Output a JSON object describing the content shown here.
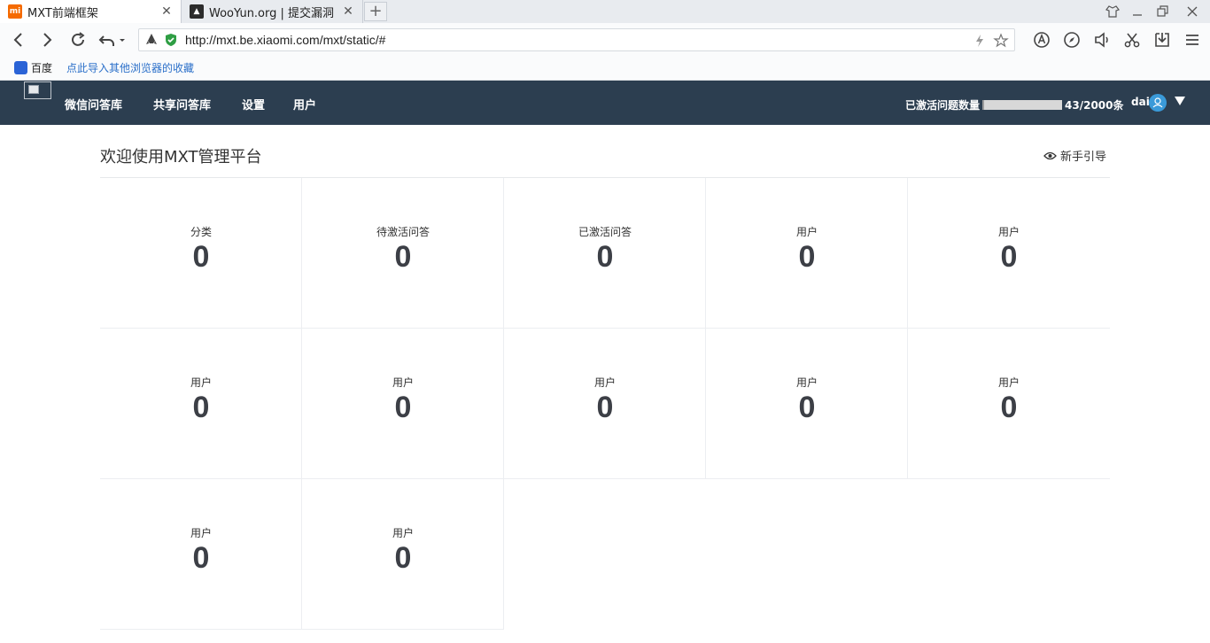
{
  "browser": {
    "tabs": [
      {
        "title": "MXT前端框架",
        "favicon_color": "#f56a00",
        "active": true
      },
      {
        "title": "WooYun.org | 提交漏洞",
        "favicon_color": "#2b2b2b",
        "active": false
      }
    ],
    "url": "http://mxt.be.xiaomi.com/mxt/static/#",
    "bookmarks": {
      "baidu": "百度",
      "import": "点此导入其他浏览器的收藏"
    }
  },
  "app": {
    "nav": [
      "微信问答库",
      "共享问答库",
      "设置",
      "用户"
    ],
    "quota_label": "已激活问题数量",
    "quota_text": "43/2000条",
    "quota_fraction": 0.0215,
    "user": "dai"
  },
  "main": {
    "title": "欢迎使用MXT管理平台",
    "guide": "新手引导",
    "stats": [
      {
        "label": "分类",
        "value": "0"
      },
      {
        "label": "待激活问答",
        "value": "0"
      },
      {
        "label": "已激活问答",
        "value": "0"
      },
      {
        "label": "用户",
        "value": "0"
      },
      {
        "label": "用户",
        "value": "0"
      },
      {
        "label": "用户",
        "value": "0"
      },
      {
        "label": "用户",
        "value": "0"
      },
      {
        "label": "用户",
        "value": "0"
      },
      {
        "label": "用户",
        "value": "0"
      },
      {
        "label": "用户",
        "value": "0"
      },
      {
        "label": "用户",
        "value": "0"
      },
      {
        "label": "用户",
        "value": "0"
      }
    ]
  },
  "colors": {
    "header_bg": "#2c3e50",
    "accent_blue": "#3a9ad9",
    "link_blue": "#2a6fc9"
  }
}
